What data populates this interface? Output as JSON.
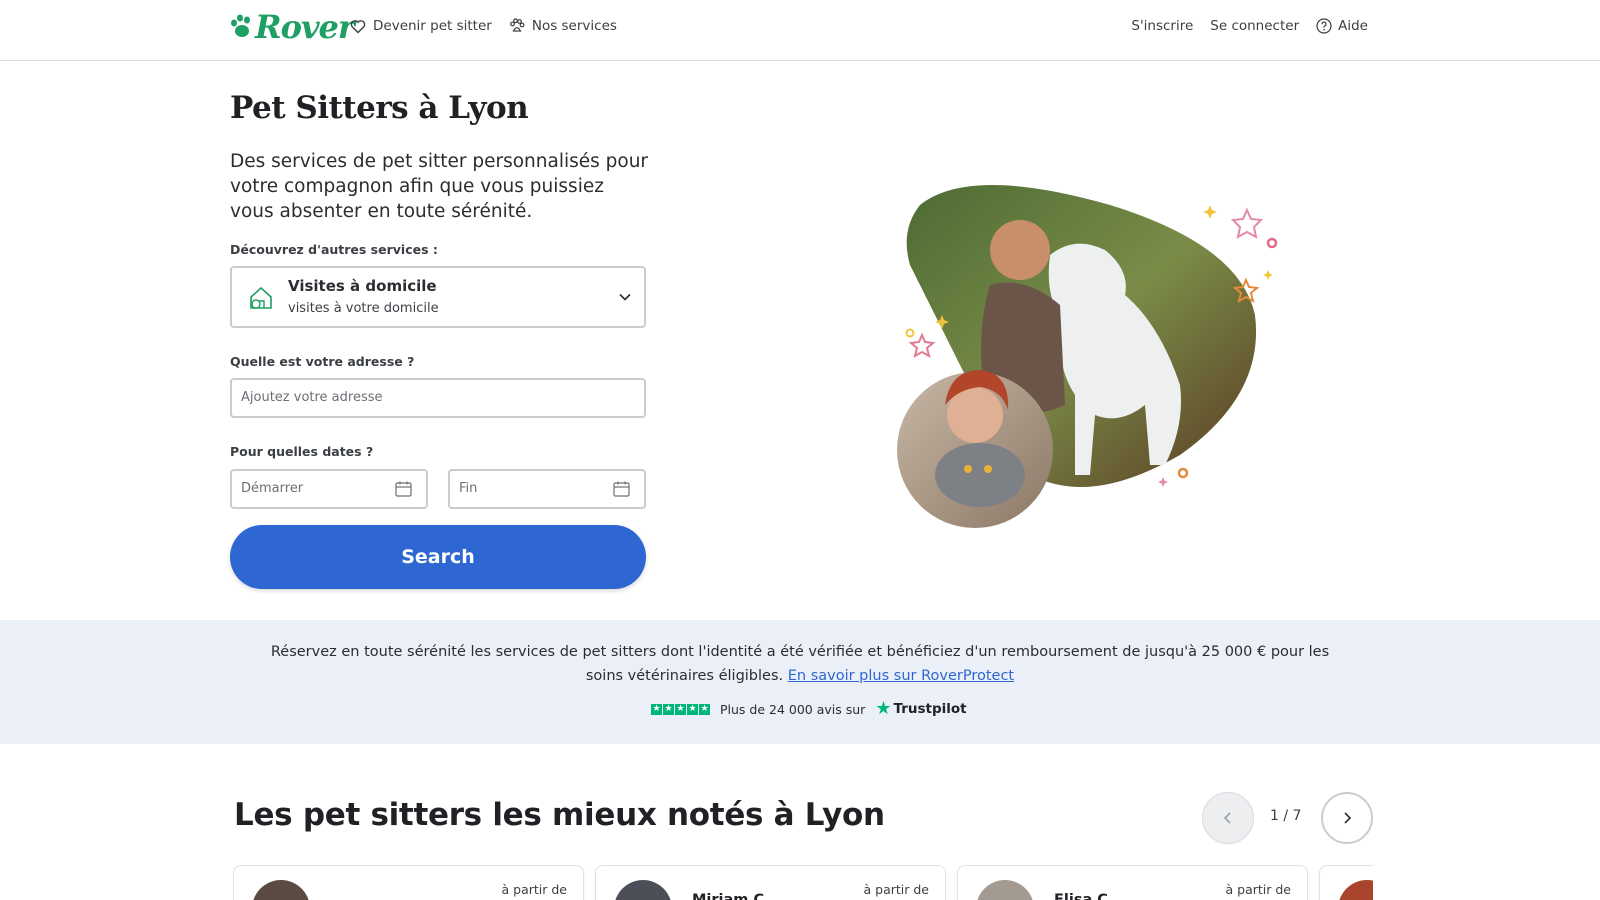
{
  "brand": {
    "name": "Rover",
    "color": "#1e9f64"
  },
  "nav": {
    "left": [
      {
        "label": "Devenir pet sitter",
        "icon": "heart-icon"
      },
      {
        "label": "Nos services",
        "icon": "paw-icon"
      }
    ],
    "signup": "S'inscrire",
    "login": "Se connecter",
    "help": "Aide"
  },
  "hero": {
    "title": "Pet Sitters à Lyon",
    "subtitle": "Des services de pet sitter personnalisés pour votre compagnon afin que vous puissiez vous absenter en toute sérénité.",
    "service_label": "Découvrez d'autres services :",
    "service": {
      "title": "Visites à domicile",
      "description": "visites à votre domicile"
    },
    "address_label": "Quelle est votre adresse ?",
    "address_placeholder": "Ajoutez votre adresse",
    "dates_label": "Pour quelles dates ?",
    "start_placeholder": "Démarrer",
    "end_placeholder": "Fin",
    "search_label": "Search"
  },
  "trust": {
    "text": "Réservez en toute sérénité les services de pet sitters dont l'identité a été vérifiée et bénéficiez d'un remboursement de jusqu'à 25 000 € pour les soins vétérinaires éligibles.",
    "link": "En savoir plus sur RoverProtect",
    "reviews": "Plus de 24 000 avis sur",
    "trustpilot": "Trustpilot",
    "accent": "#00b67a"
  },
  "top_rated": {
    "title": "Les pet sitters les mieux notés à Lyon",
    "pager": "1 / 7",
    "cards": [
      {
        "name": "",
        "from": "à partir de"
      },
      {
        "name": "Miriam C.",
        "from": "à partir de"
      },
      {
        "name": "Elisa C.",
        "from": "à partir de"
      }
    ]
  },
  "colors": {
    "primary": "#2e67d1",
    "band": "#ebf0f8"
  }
}
